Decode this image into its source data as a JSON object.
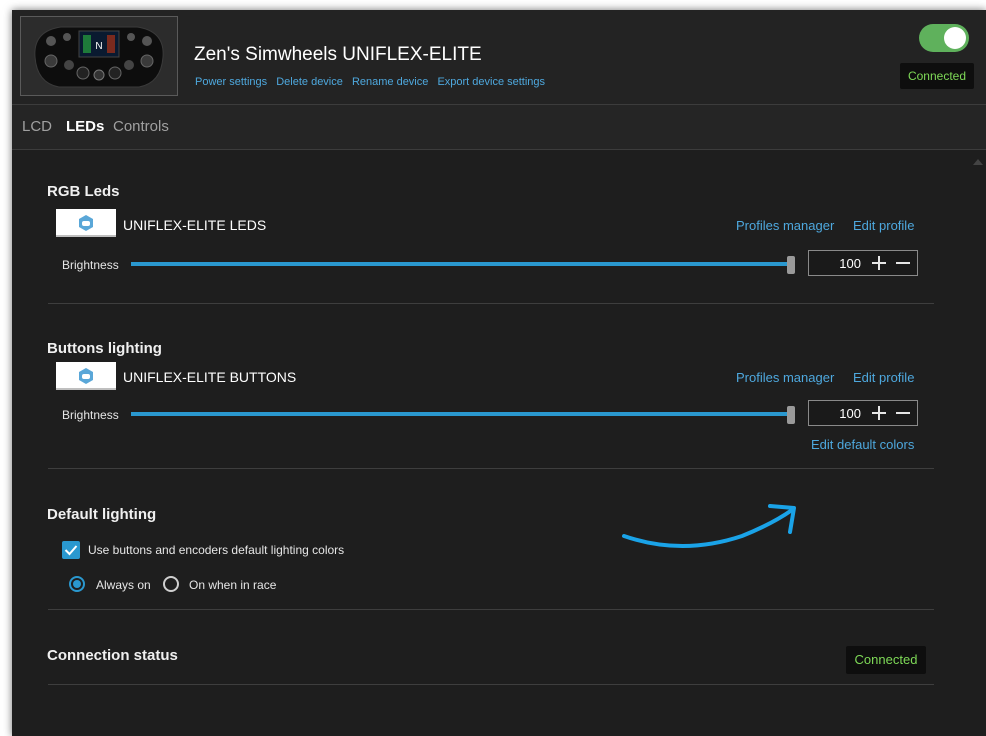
{
  "device": {
    "name": "Zen's Simwheels UNIFLEX-ELITE",
    "links": [
      "Power settings",
      "Delete device",
      "Rename device",
      "Export device settings"
    ],
    "enabled": true,
    "status": "Connected"
  },
  "tabs": [
    {
      "label": "LCD",
      "active": false
    },
    {
      "label": "LEDs",
      "active": true
    },
    {
      "label": "Controls",
      "active": false
    }
  ],
  "rgb_leds": {
    "title": "RGB Leds",
    "profile_name": "UNIFLEX-ELITE LEDS",
    "profiles_manager": "Profiles manager",
    "edit_profile": "Edit profile",
    "brightness_label": "Brightness",
    "brightness_value": "100",
    "brightness_fraction": 1.0
  },
  "buttons_lighting": {
    "title": "Buttons lighting",
    "profile_name": "UNIFLEX-ELITE BUTTONS",
    "profiles_manager": "Profiles manager",
    "edit_profile": "Edit profile",
    "brightness_label": "Brightness",
    "brightness_value": "100",
    "brightness_fraction": 1.0,
    "edit_default_colors": "Edit default colors"
  },
  "default_lighting": {
    "title": "Default lighting",
    "checkbox_label": "Use buttons and encoders default lighting colors",
    "checkbox_checked": true,
    "radio_options": [
      {
        "label": "Always on",
        "selected": true
      },
      {
        "label": "On when in race",
        "selected": false
      }
    ]
  },
  "connection_status": {
    "title": "Connection status",
    "status": "Connected"
  },
  "colors": {
    "accent": "#2a98cf",
    "link": "#4ea8de",
    "connected_text": "#7ed957",
    "toggle_on": "#5fb15c",
    "annotation_arrow": "#1aa3e8"
  }
}
